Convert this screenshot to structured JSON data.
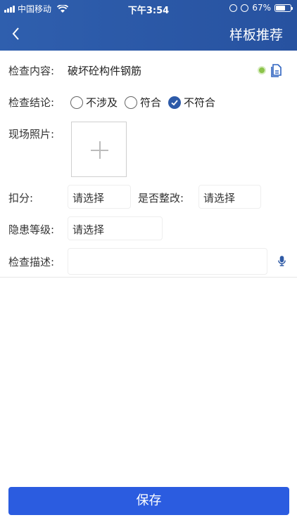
{
  "status_bar": {
    "carrier": "中国移动",
    "time": "下午3:54",
    "battery": "67%",
    "battery_level": 0.67
  },
  "header": {
    "back_icon": "chevron-left-icon",
    "title": "样板推荐"
  },
  "form": {
    "content": {
      "label": "检查内容:",
      "value": "破坏砼构件钢筋",
      "status_color": "#8bc34a"
    },
    "conclusion": {
      "label": "检查结论:",
      "options": [
        "不涉及",
        "符合",
        "不符合"
      ],
      "selected": "不符合"
    },
    "photo": {
      "label": "现场照片:"
    },
    "score": {
      "label": "扣分:",
      "placeholder": "请选择"
    },
    "rectify": {
      "label": "是否整改:",
      "placeholder": "请选择"
    },
    "hazard_level": {
      "label": "隐患等级:",
      "placeholder": "请选择"
    },
    "description": {
      "label": "检查描述:",
      "value": ""
    }
  },
  "colors": {
    "accent": "#2752a0",
    "button": "#2b5ce0"
  },
  "save_label": "保存"
}
